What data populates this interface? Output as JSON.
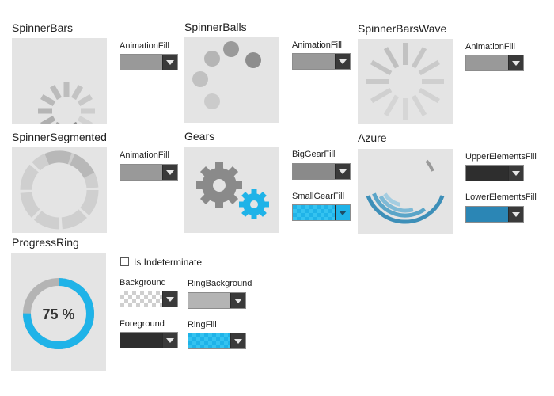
{
  "sections": {
    "spinner_bars": {
      "title": "SpinnerBars",
      "picker_label": "AnimationFill",
      "picker_color": "#999999"
    },
    "spinner_balls": {
      "title": "SpinnerBalls",
      "picker_label": "AnimationFill",
      "picker_color": "#999999"
    },
    "spinner_bars_wave": {
      "title": "SpinnerBarsWave",
      "picker_label": "AnimationFill",
      "picker_color": "#999999"
    },
    "spinner_segmented": {
      "title": "SpinnerSegmented",
      "picker_label": "AnimationFill",
      "picker_color": "#999999"
    },
    "gears": {
      "title": "Gears",
      "big_gear_label": "BigGearFill",
      "big_gear_color": "#8a8a8a",
      "small_gear_label": "SmallGearFill",
      "small_gear_color": "#1fb3e8"
    },
    "azure": {
      "title": "Azure",
      "upper_label": "UpperElementsFill",
      "upper_color": "#2e2e2e",
      "lower_label": "LowerElementsFill",
      "lower_color": "#2b86b5"
    },
    "progress_ring": {
      "title": "ProgressRing",
      "value_text": "75 %",
      "progress": 0.75,
      "is_indeterminate_label": "Is Indeterminate",
      "is_indeterminate": false,
      "background_label": "Background",
      "ring_background_label": "RingBackground",
      "ring_background_color": "#b4b4b4",
      "foreground_label": "Foreground",
      "foreground_color": "#2e2e2e",
      "ring_fill_label": "RingFill",
      "ring_fill_color": "#1fb3e8"
    }
  }
}
